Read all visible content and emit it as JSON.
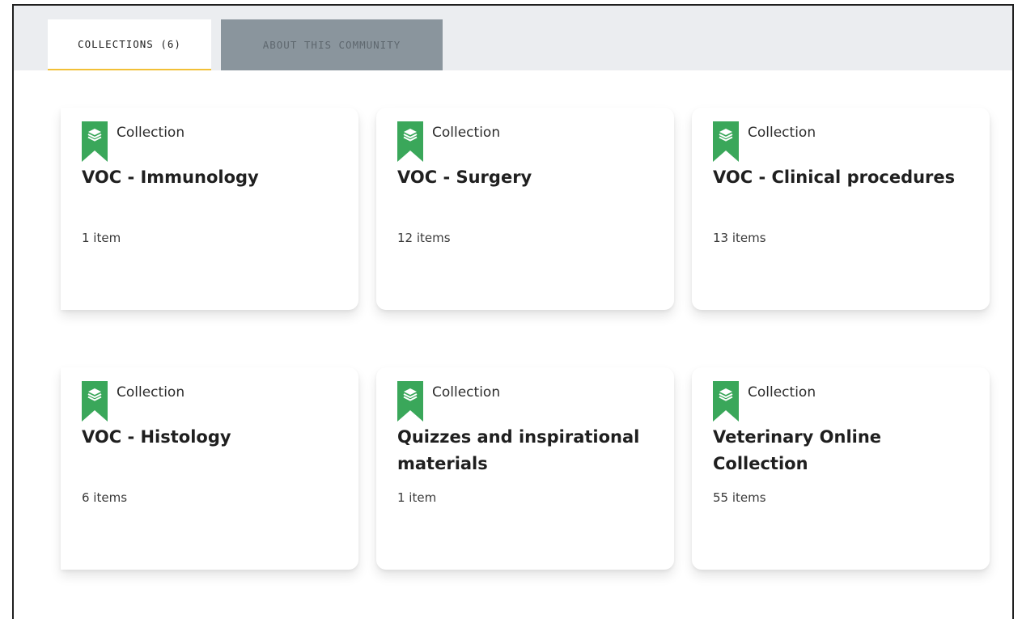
{
  "tabs": [
    {
      "label": "COLLECTIONS (6)",
      "active": true
    },
    {
      "label": "ABOUT THIS COMMUNITY",
      "active": false
    }
  ],
  "colors": {
    "accent": "#f2c037",
    "ribbon": "#3aa75a",
    "inactive_tab": "#8a959d",
    "tabbar_bg": "#ebedf0"
  },
  "collections": [
    {
      "type": "Collection",
      "icon": "collection-ribbon-icon",
      "title": "VOC - Immunology",
      "count": "1 item"
    },
    {
      "type": "Collection",
      "icon": "collection-ribbon-icon",
      "title": "VOC - Surgery",
      "count": "12 items"
    },
    {
      "type": "Collection",
      "icon": "collection-ribbon-icon",
      "title": "VOC - Clinical procedures",
      "count": "13 items"
    },
    {
      "type": "Collection",
      "icon": "collection-ribbon-icon",
      "title": "VOC - Histology",
      "count": "6 items"
    },
    {
      "type": "Collection",
      "icon": "collection-ribbon-icon",
      "title": "Quizzes and inspirational materials",
      "count": "1 item"
    },
    {
      "type": "Collection",
      "icon": "collection-ribbon-icon",
      "title": "Veterinary Online Collection",
      "count": "55 items"
    }
  ]
}
